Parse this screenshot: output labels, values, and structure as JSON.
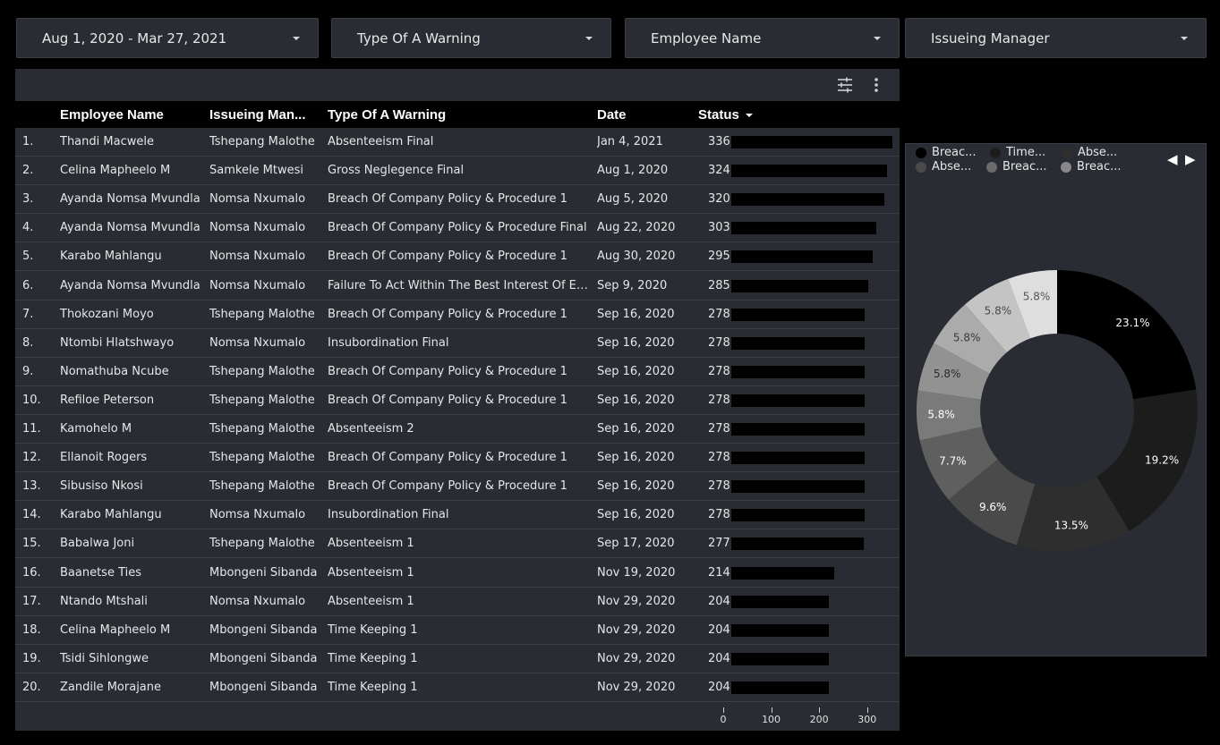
{
  "filters": [
    {
      "label": "Aug 1, 2020 - Mar 27, 2021"
    },
    {
      "label": "Type Of A Warning"
    },
    {
      "label": "Employee Name"
    },
    {
      "label": "Issueing Manager"
    }
  ],
  "table": {
    "headers": {
      "employee": "Employee Name",
      "manager": "Issueing Man...",
      "warning": "Type Of A Warning",
      "date": "Date",
      "status": "Status"
    },
    "rows": [
      {
        "num": "1.",
        "employee": "Thandi Macwele",
        "manager": "Tshepang Malothe",
        "warning": "Absenteeism Final",
        "date": "Jan 4, 2021",
        "status": 336
      },
      {
        "num": "2.",
        "employee": "Celina Mapheelo M",
        "manager": "Samkele Mtwesi",
        "warning": "Gross Neglegence Final",
        "date": "Aug 1, 2020",
        "status": 324
      },
      {
        "num": "3.",
        "employee": "Ayanda Nomsa Mvundla",
        "manager": "Nomsa Nxumalo",
        "warning": "Breach Of Company Policy & Procedure 1",
        "date": "Aug 5, 2020",
        "status": 320
      },
      {
        "num": "4.",
        "employee": "Ayanda Nomsa Mvundla",
        "manager": "Nomsa Nxumalo",
        "warning": "Breach Of Company Policy & Procedure Final",
        "date": "Aug 22, 2020",
        "status": 303
      },
      {
        "num": "5.",
        "employee": "Karabo Mahlangu",
        "manager": "Nomsa Nxumalo",
        "warning": "Breach Of Company Policy & Procedure 1",
        "date": "Aug 30, 2020",
        "status": 295
      },
      {
        "num": "6.",
        "employee": "Ayanda Nomsa Mvundla",
        "manager": "Nomsa Nxumalo",
        "warning": "Failure To Act Within The Best Interest Of Em...",
        "date": "Sep 9, 2020",
        "status": 285
      },
      {
        "num": "7.",
        "employee": "Thokozani Moyo",
        "manager": "Tshepang Malothe",
        "warning": "Breach Of Company Policy & Procedure 1",
        "date": "Sep 16, 2020",
        "status": 278
      },
      {
        "num": "8.",
        "employee": "Ntombi Hlatshwayo",
        "manager": "Nomsa Nxumalo",
        "warning": "Insubordination Final",
        "date": "Sep 16, 2020",
        "status": 278
      },
      {
        "num": "9.",
        "employee": "Nomathuba Ncube",
        "manager": "Tshepang Malothe",
        "warning": "Breach Of Company Policy & Procedure 1",
        "date": "Sep 16, 2020",
        "status": 278
      },
      {
        "num": "10.",
        "employee": "Refiloe Peterson",
        "manager": "Tshepang Malothe",
        "warning": "Breach Of Company Policy & Procedure 1",
        "date": "Sep 16, 2020",
        "status": 278
      },
      {
        "num": "11.",
        "employee": "Kamohelo M",
        "manager": "Tshepang Malothe",
        "warning": "Absenteeism 2",
        "date": "Sep 16, 2020",
        "status": 278
      },
      {
        "num": "12.",
        "employee": "Ellanoit Rogers",
        "manager": "Tshepang Malothe",
        "warning": "Breach Of Company Policy & Procedure 1",
        "date": "Sep 16, 2020",
        "status": 278
      },
      {
        "num": "13.",
        "employee": "Sibusiso Nkosi",
        "manager": "Tshepang Malothe",
        "warning": "Breach Of Company Policy & Procedure 1",
        "date": "Sep 16, 2020",
        "status": 278
      },
      {
        "num": "14.",
        "employee": "Karabo Mahlangu",
        "manager": "Nomsa Nxumalo",
        "warning": "Insubordination Final",
        "date": "Sep 16, 2020",
        "status": 278
      },
      {
        "num": "15.",
        "employee": "Babalwa Joni",
        "manager": "Tshepang Malothe",
        "warning": "Absenteeism 1",
        "date": "Sep 17, 2020",
        "status": 277
      },
      {
        "num": "16.",
        "employee": "Baanetse Ties",
        "manager": "Mbongeni Sibanda",
        "warning": "Absenteeism 1",
        "date": "Nov 19, 2020",
        "status": 214
      },
      {
        "num": "17.",
        "employee": "Ntando Mtshali",
        "manager": "Nomsa Nxumalo",
        "warning": "Absenteeism 1",
        "date": "Nov 29, 2020",
        "status": 204
      },
      {
        "num": "18.",
        "employee": "Celina Mapheelo M",
        "manager": "Mbongeni Sibanda",
        "warning": "Time Keeping 1",
        "date": "Nov 29, 2020",
        "status": 204
      },
      {
        "num": "19.",
        "employee": "Tsidi Sihlongwe",
        "manager": "Mbongeni Sibanda",
        "warning": "Time Keeping 1",
        "date": "Nov 29, 2020",
        "status": 204
      },
      {
        "num": "20.",
        "employee": "Zandile Morajane",
        "manager": "Mbongeni Sibanda",
        "warning": "Time Keeping 1",
        "date": "Nov 29, 2020",
        "status": 204
      }
    ],
    "axis_ticks": [
      0,
      100,
      200,
      300
    ],
    "axis_max": 336,
    "bar_color": "#000000"
  },
  "donut": {
    "legend": [
      {
        "label": "Breac...",
        "color": "#000000"
      },
      {
        "label": "Time...",
        "color": "#1c1c1c"
      },
      {
        "label": "Abse...",
        "color": "#2e2e2e"
      },
      {
        "label": "Abse...",
        "color": "#4a4a4a"
      },
      {
        "label": "Breac...",
        "color": "#6b6b6b"
      },
      {
        "label": "Breac...",
        "color": "#888888"
      }
    ],
    "pager_prev": "◀",
    "pager_next": "▶"
  },
  "chart_data": {
    "type": "pie",
    "variant": "donut",
    "slices": [
      {
        "label": "23.1%",
        "value": 23.1,
        "color": "#000000",
        "text_color": "#ffffff"
      },
      {
        "label": "19.2%",
        "value": 19.2,
        "color": "#1c1c1c",
        "text_color": "#ffffff"
      },
      {
        "label": "13.5%",
        "value": 13.5,
        "color": "#2e2e2e",
        "text_color": "#ffffff"
      },
      {
        "label": "9.6%",
        "value": 9.6,
        "color": "#4a4a4a",
        "text_color": "#ffffff"
      },
      {
        "label": "7.7%",
        "value": 7.7,
        "color": "#5f5f5f",
        "text_color": "#ffffff"
      },
      {
        "label": "5.8%",
        "value": 5.8,
        "color": "#7a7a7a",
        "text_color": "#ffffff"
      },
      {
        "label": "5.8%",
        "value": 5.8,
        "color": "#929292",
        "text_color": "#2a2a2a"
      },
      {
        "label": "5.8%",
        "value": 5.8,
        "color": "#ababab",
        "text_color": "#3a3a3a"
      },
      {
        "label": "5.8%",
        "value": 5.8,
        "color": "#c4c4c4",
        "text_color": "#4a4a4a"
      },
      {
        "label": "5.8%",
        "value": 5.8,
        "color": "#dedede",
        "text_color": "#555555"
      }
    ],
    "legend_placement": "top",
    "start_angle_deg": 0,
    "direction": "clockwise"
  }
}
